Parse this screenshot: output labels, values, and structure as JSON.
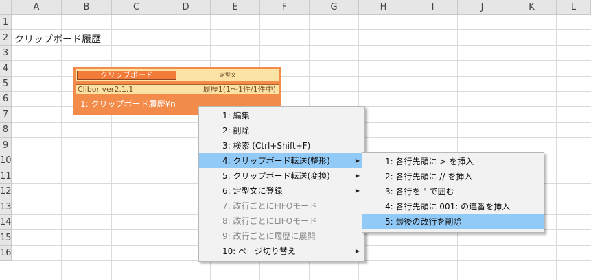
{
  "sheet": {
    "columns": [
      "A",
      "B",
      "C",
      "D",
      "E",
      "F",
      "G",
      "H",
      "I",
      "J",
      "K",
      "L"
    ],
    "rows": [
      "1",
      "2",
      "3",
      "4",
      "5",
      "6",
      "7",
      "8",
      "9",
      "10",
      "11",
      "12",
      "13",
      "14",
      "15",
      "16"
    ],
    "cell_a2": "クリップボード履歴"
  },
  "clibor": {
    "tab_active": "クリップボード",
    "tab_other": "定型文",
    "version": "Clibor ver2.1.1",
    "history_status": "履歴1(1～1件/1件中)",
    "item_1": "1:  クリップボード履歴¥n"
  },
  "context_menu": {
    "items": [
      {
        "label": "1: 編集"
      },
      {
        "label": "2: 削除"
      },
      {
        "label": "3: 検索 (Ctrl+Shift+F)"
      },
      {
        "label": "4: クリップボード転送(整形)"
      },
      {
        "label": "5: クリップボード転送(変換)"
      },
      {
        "label": "6: 定型文に登録"
      },
      {
        "label": "7: 改行ごとにFIFOモード"
      },
      {
        "label": "8: 改行ごとにLIFOモード"
      },
      {
        "label": "9: 改行ごとに履歴に展開"
      },
      {
        "label": "10: ページ切り替え"
      }
    ]
  },
  "submenu": {
    "items": [
      {
        "label": "1: 各行先頭に > を挿入"
      },
      {
        "label": "2: 各行先頭に // を挿入"
      },
      {
        "label": "3: 各行を \" で囲む"
      },
      {
        "label": "4: 各行先頭に 001: の連番を挿入"
      },
      {
        "label": "5: 最後の改行を削除"
      }
    ]
  },
  "icons": {
    "submenu_arrow": "triangle-right-icon"
  }
}
